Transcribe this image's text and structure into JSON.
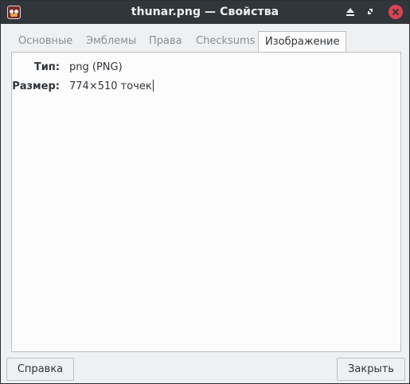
{
  "window": {
    "title": "thunar.png — Свойства",
    "app_icon": "thunar-icon"
  },
  "titlebar_buttons": [
    "eject-icon",
    "restore-icon",
    "close-icon"
  ],
  "colors": {
    "close_button": "#da4453",
    "titlebar": "#31363b",
    "panel_bg": "#fcfcfc"
  },
  "tabs": [
    {
      "label": "Основные",
      "active": false
    },
    {
      "label": "Эмблемы",
      "active": false
    },
    {
      "label": "Права",
      "active": false
    },
    {
      "label": "Checksums",
      "active": false
    },
    {
      "label": "Изображение",
      "active": true
    }
  ],
  "properties": {
    "type_label": "Тип:",
    "type_value": "png (PNG)",
    "size_label": "Размер:",
    "size_value": "774×510 точек"
  },
  "buttons": {
    "help": "Справка",
    "close": "Закрыть"
  }
}
